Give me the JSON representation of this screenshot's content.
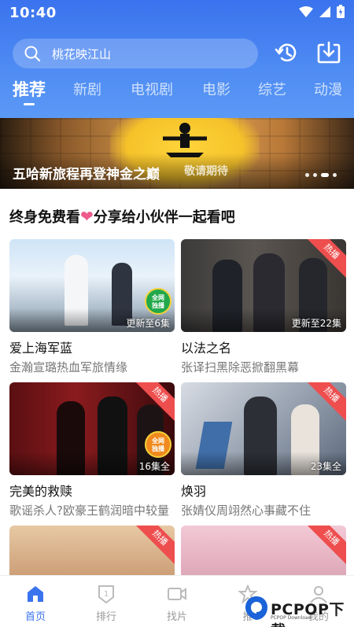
{
  "status_bar": {
    "time": "10:40"
  },
  "search": {
    "placeholder": "桃花映江山"
  },
  "tabs": [
    {
      "label": "推荐",
      "active": true
    },
    {
      "label": "新剧"
    },
    {
      "label": "电视剧"
    },
    {
      "label": "电影"
    },
    {
      "label": "综艺"
    },
    {
      "label": "动漫"
    }
  ],
  "banner": {
    "title": "五哈新旅程再登神金之巅",
    "subtitle": "敬请期待",
    "dot_count": 4,
    "active_dot": 3
  },
  "section": {
    "title_before": "终身免费看",
    "heart": "❤",
    "title_after": "分享给小伙伴一起看吧"
  },
  "cards": [
    {
      "title": "爱上海军蓝",
      "desc": "金瀚宣璐热血军旅情缘",
      "episode": "更新至6集",
      "badge_round": "全网独播",
      "ribbon": ""
    },
    {
      "title": "以法之名",
      "desc": "张译扫黑除恶掀翻黑幕",
      "episode": "更新至22集",
      "badge_round": "",
      "ribbon": "热播"
    },
    {
      "title": "完美的救赎",
      "desc": "歌谣杀人?欧豪王鹤润暗中较量",
      "episode": "16集全",
      "badge_round": "全网独播",
      "ribbon": "热播"
    },
    {
      "title": "焕羽",
      "desc": "张婧仪周翊然心事藏不住",
      "episode": "23集全",
      "badge_round": "",
      "ribbon": "热播"
    },
    {
      "title": "",
      "desc": "",
      "episode": "",
      "badge_round": "",
      "ribbon": "热播"
    },
    {
      "title": "",
      "desc": "",
      "episode": "",
      "badge_round": "",
      "ribbon": "热播"
    }
  ],
  "bottom_nav": [
    {
      "label": "首页",
      "icon": "home-icon",
      "active": true
    },
    {
      "label": "排行",
      "icon": "ranking-icon"
    },
    {
      "label": "找片",
      "icon": "video-camera-icon"
    },
    {
      "label": "推",
      "icon": "recommend-icon"
    },
    {
      "label": "我的",
      "icon": "user-icon"
    }
  ],
  "watermark": {
    "text": "PCPOP下载",
    "sub": "PCPOP Download"
  },
  "colors": {
    "accent": "#3a73ee",
    "ribbon": "#ee4e4e",
    "heart": "#ee5a8a"
  }
}
